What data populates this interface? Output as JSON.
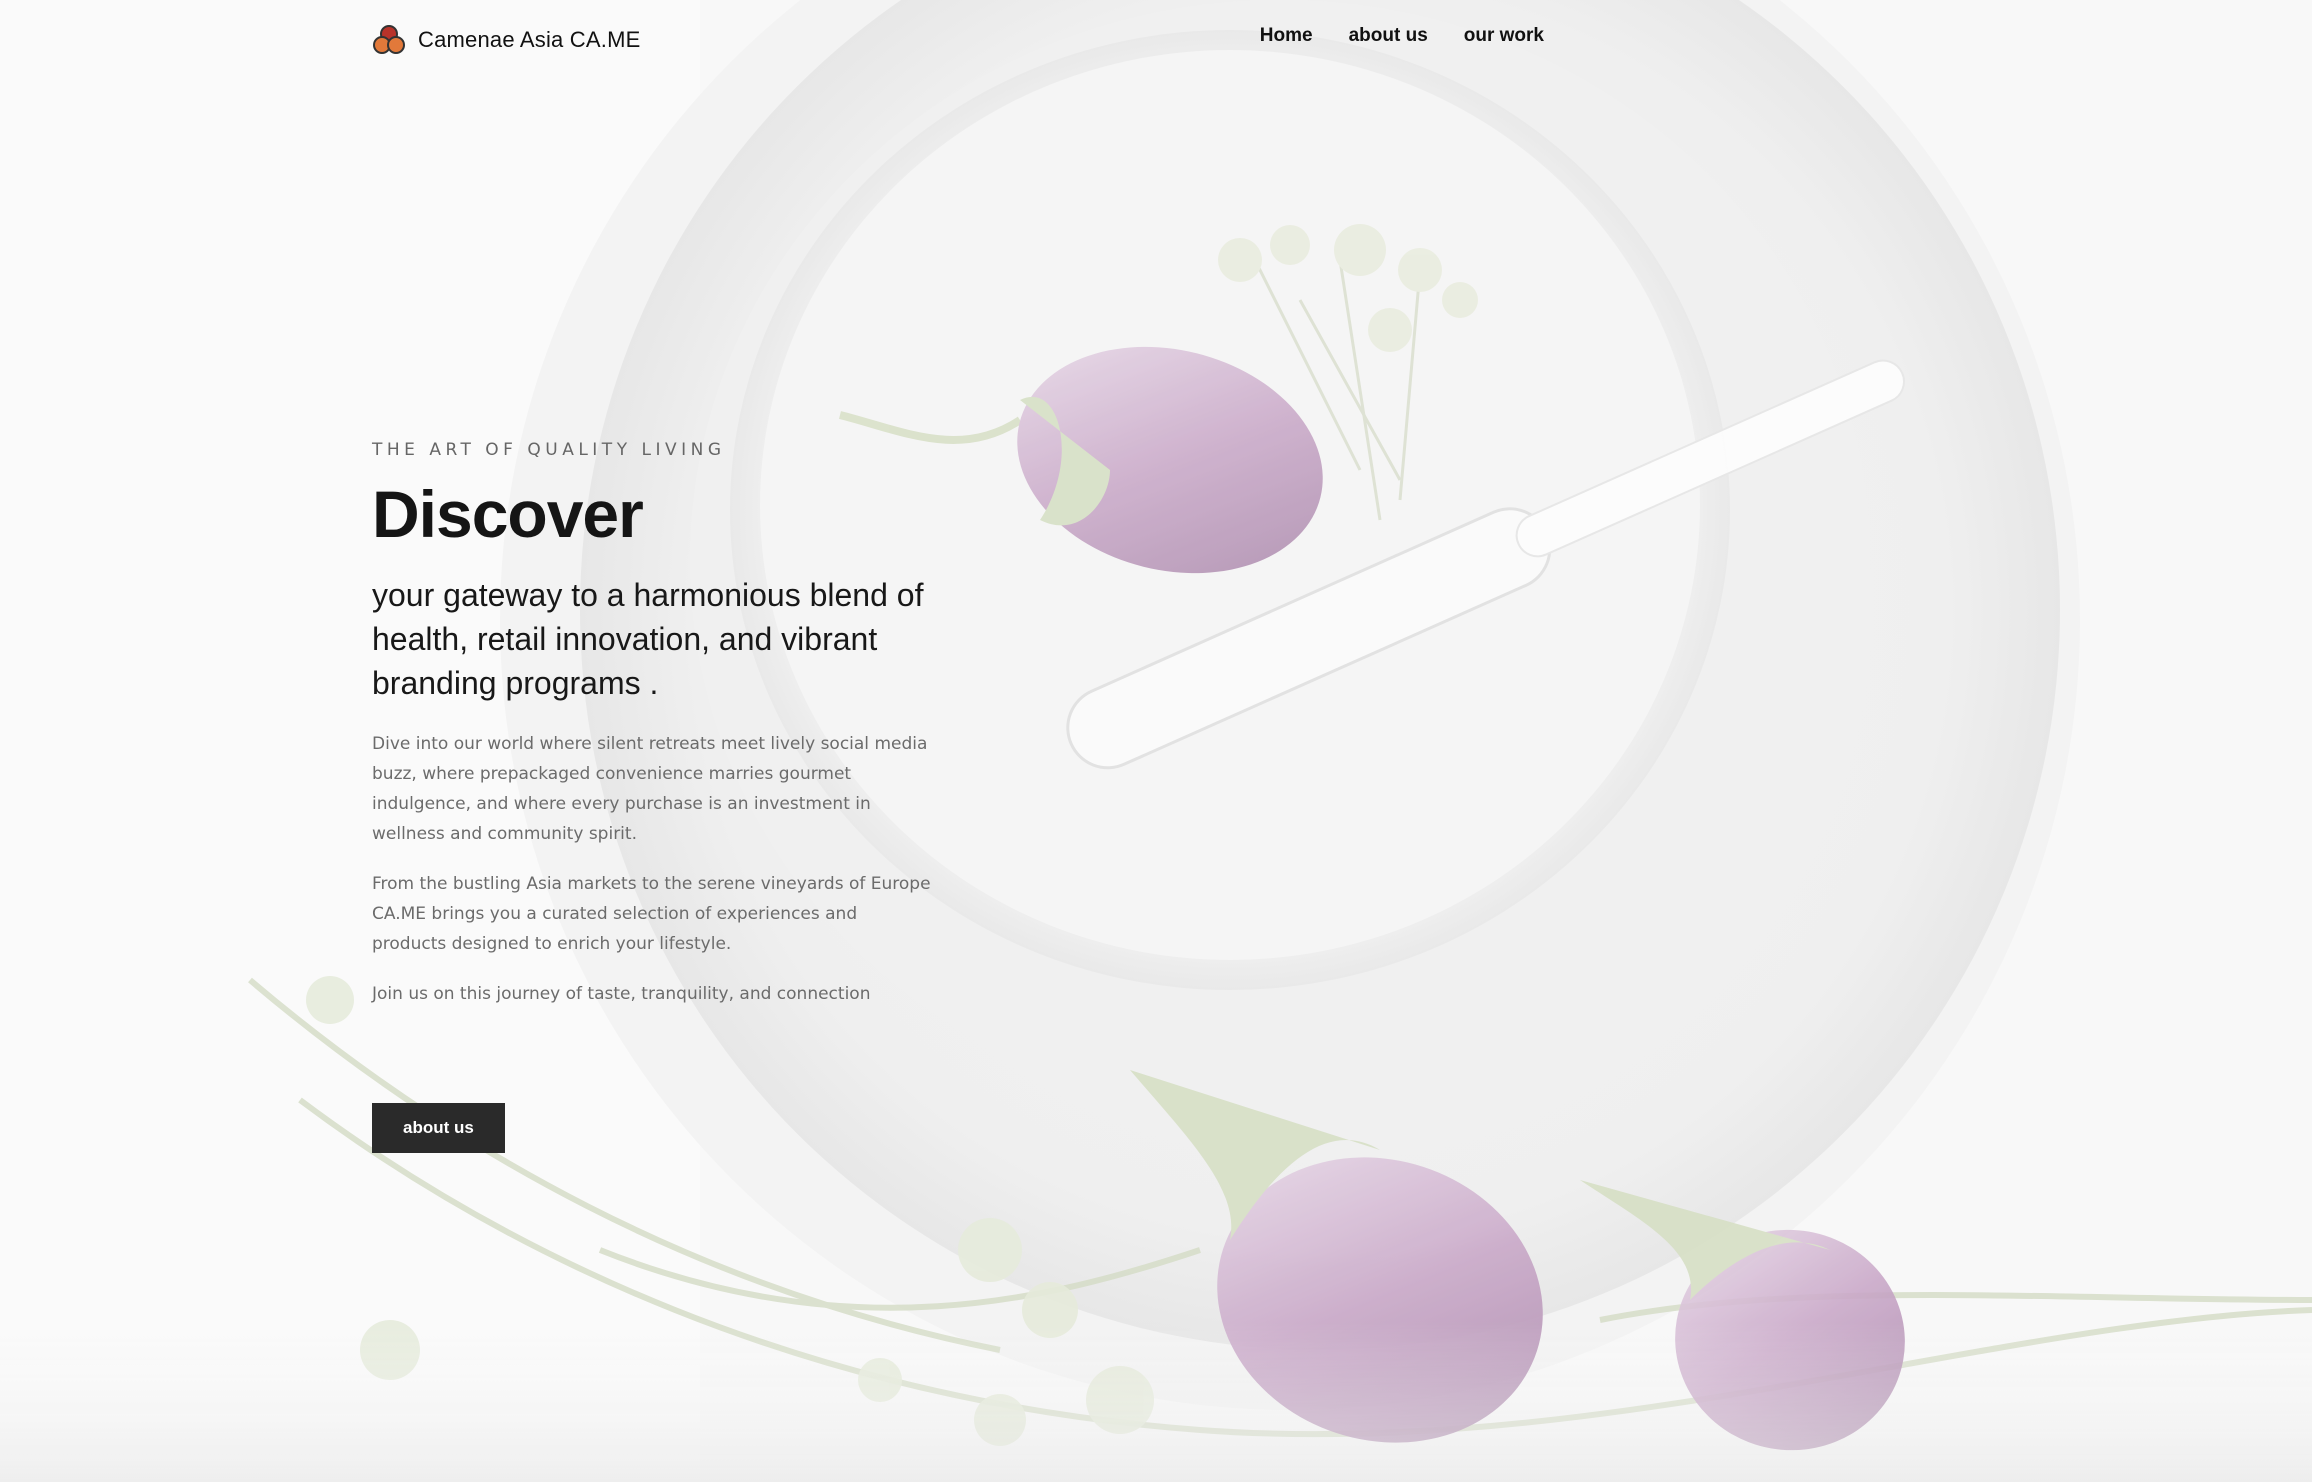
{
  "header": {
    "brand_name": "Camenae Asia CA.ME",
    "logo_icon": "three-circles-logo-icon",
    "nav": [
      {
        "label": "Home"
      },
      {
        "label": "about us"
      },
      {
        "label": "our work"
      }
    ]
  },
  "hero": {
    "eyebrow": "THE ART OF QUALITY LIVING",
    "title": "Discover",
    "subtitle": "your gateway to a harmonious blend of health, retail innovation, and vibrant branding programs .",
    "paragraphs": [
      " Dive into our world where silent retreats meet lively social media buzz, where prepackaged convenience marries gourmet indulgence, and where every purchase is an investment in wellness and community spirit.",
      "From the bustling Asia markets to the serene vineyards of Europe CA.ME brings you a curated selection of experiences and products designed to enrich your lifestyle.",
      "Join us on this journey of taste, tranquility, and connection"
    ],
    "cta_label": "about us"
  },
  "colors": {
    "text_dark": "#151515",
    "text_muted": "#6b6b6b",
    "button_bg": "#2a2a2a",
    "logo_orange": "#e2793a",
    "logo_red": "#b8332a",
    "eggplant": "#b995ba"
  }
}
